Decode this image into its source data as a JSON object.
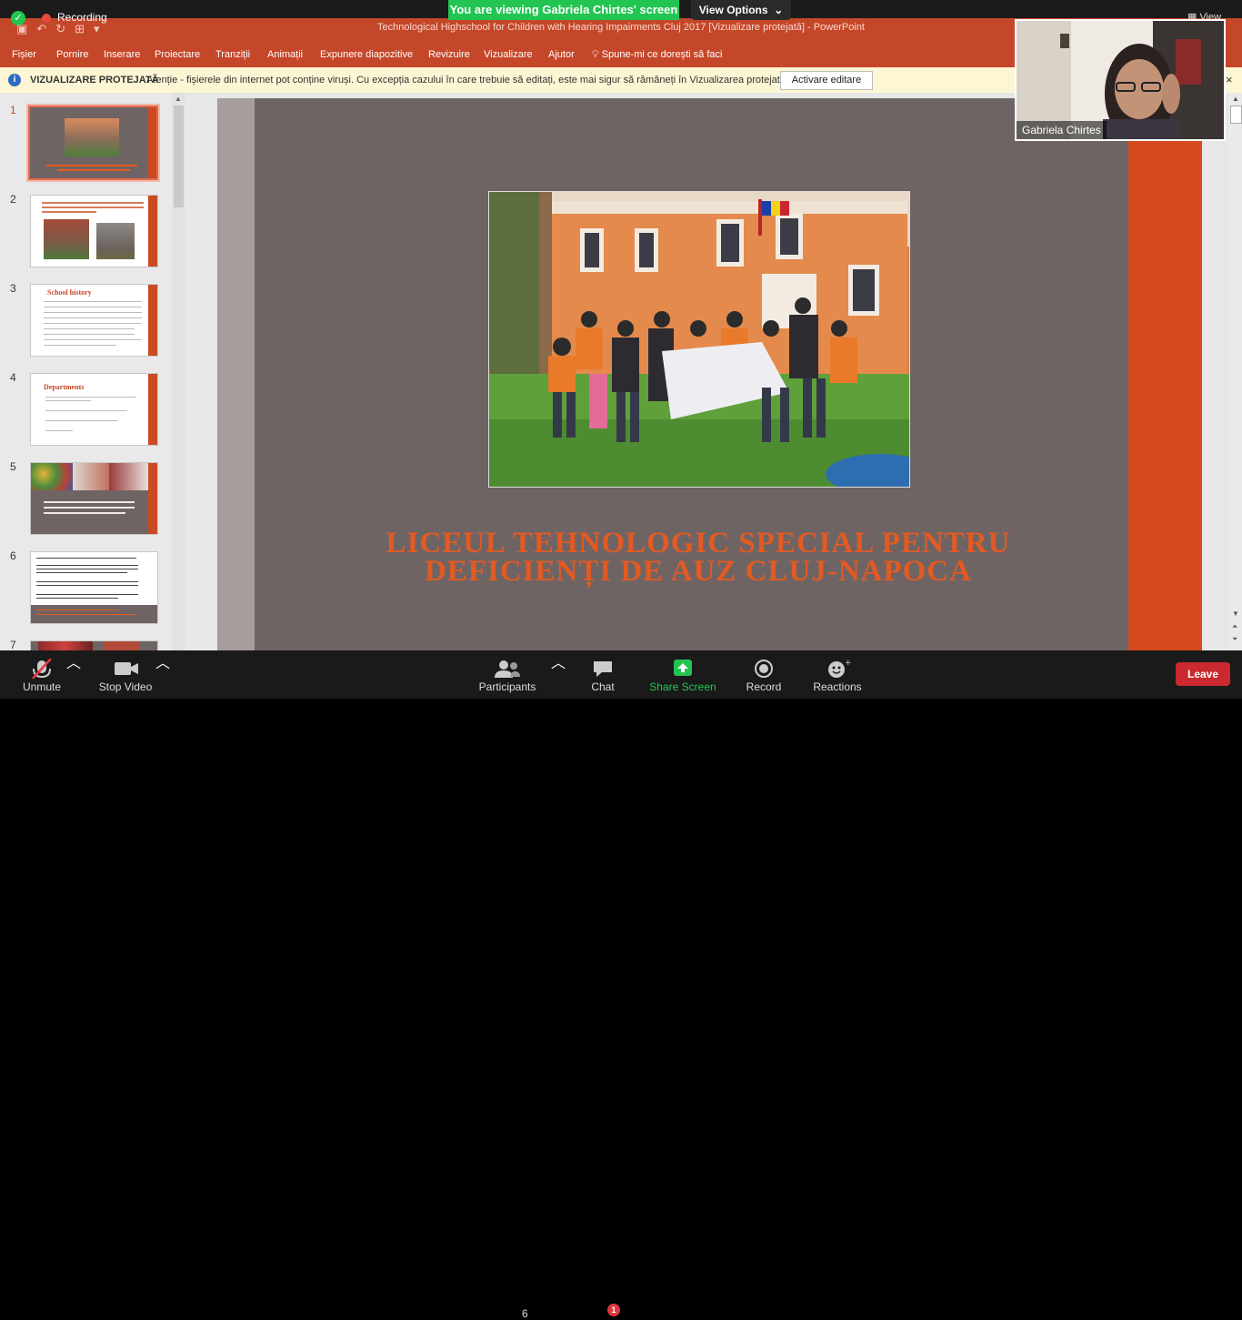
{
  "zoom": {
    "recording_label": "Recording",
    "viewing_banner": "You are viewing Gabriela Chirtes' screen",
    "view_options": "View Options",
    "view_top_right": "View",
    "participant_name": "Gabriela Chirtes",
    "toolbar": {
      "unmute": "Unmute",
      "stop_video": "Stop Video",
      "participants": "Participants",
      "participants_count": "6",
      "chat": "Chat",
      "chat_badge": "1",
      "share_screen": "Share Screen",
      "record": "Record",
      "reactions": "Reactions",
      "leave": "Leave"
    }
  },
  "powerpoint": {
    "document_title": "Technological Highschool for Children with Hearing Impairments Cluj 2017  [Vizualizare protejată]  -  PowerPoint",
    "ribbon": [
      "Fișier",
      "Pornire",
      "Inserare",
      "Proiectare",
      "Tranziții",
      "Animații",
      "Expunere diapozitive",
      "Revizuire",
      "Vizualizare",
      "Ajutor",
      "Spune-mi ce dorești să faci"
    ],
    "protected_view": {
      "title": "VIZUALIZARE PROTEJATĂ",
      "message": "Atenție - fișierele din internet pot conține viruși. Cu excepția cazului în care trebuie să editați, este mai sigur să rămâneți în Vizualizarea protejată.",
      "button": "Activare editare",
      "close": "×"
    },
    "thumbnails": [
      {
        "number": "1",
        "heading": "LICEUL TEHNOLOGIC SPECIAL PENTRU DEFICIENȚI DE AUZ CLUJ-NAPOCA"
      },
      {
        "number": "2",
        "heading": "Liceul Tehnologic Special pentru Deficienți de Auz Cluj"
      },
      {
        "number": "3",
        "heading": "School history"
      },
      {
        "number": "4",
        "heading": "Departments"
      },
      {
        "number": "5",
        "heading": "The Centre for Family Support and Early Rehabilitation of Children with Hearing Disabilities and Associated Disabilities"
      },
      {
        "number": "6",
        "heading": ""
      },
      {
        "number": "7",
        "heading": ""
      }
    ],
    "slide_title_line1": "LICEUL TEHNOLOGIC SPECIAL PENTRU",
    "slide_title_line2": "DEFICIENȚI DE AUZ CLUJ-NAPOCA"
  },
  "icons": {
    "security": "shield-icon",
    "mic": "mic-off-icon",
    "video": "video-camera-icon",
    "participants": "people-icon",
    "chat": "chat-bubble-icon",
    "share": "share-arrow-icon",
    "record": "record-circle-icon",
    "reactions": "smiley-icon",
    "lightbulb": "lightbulb-icon"
  },
  "colors": {
    "ribbon": "#c5472a",
    "slide_bg": "#6f6464",
    "slide_accent": "#d54b1f",
    "title_text": "#e35a22",
    "share_green": "#23c552",
    "leave_red": "#c9292f"
  }
}
